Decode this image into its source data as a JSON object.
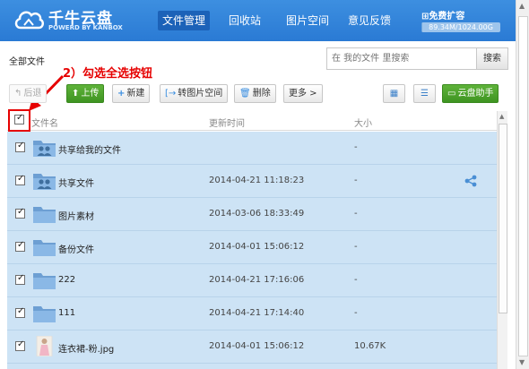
{
  "app": {
    "title": "千牛云盘",
    "subtitle": "POWERD BY KANBOX",
    "logo_icon": "cloud-icon",
    "brand_color": "#2a7ad4"
  },
  "nav": [
    {
      "label": "文件管理",
      "active": true
    },
    {
      "label": "回收站",
      "active": false
    },
    {
      "label": "图片空间",
      "active": false
    },
    {
      "label": "意见反馈",
      "active": false
    }
  ],
  "quota": {
    "title": "免费扩容",
    "usage_text": "89.34M/1024.00G",
    "used_fraction": 0.0001
  },
  "breadcrumb": "全部文件",
  "search": {
    "placeholder": "在 我的文件 里搜索",
    "button_label": "搜索"
  },
  "annotation": {
    "label": "2）勾选全选按钮",
    "color": "#e60000"
  },
  "toolbar": {
    "back_label": "后退",
    "upload_label": "上传",
    "new_label": "新建",
    "to_image_label": "转图片空间",
    "delete_label": "删除",
    "more_label": "更多 >",
    "assistant_label": "云盘助手"
  },
  "table": {
    "columns": [
      "文件名",
      "更新时间",
      "大小"
    ],
    "rows": [
      {
        "name": "共享给我的文件",
        "time": "",
        "size": "-",
        "icon": "shared-folder-icon",
        "shared": false
      },
      {
        "name": "共享文件",
        "time": "2014-04-21 11:18:23",
        "size": "-",
        "icon": "shared-folder-icon",
        "shared": true
      },
      {
        "name": "图片素材",
        "time": "2014-03-06 18:33:49",
        "size": "-",
        "icon": "folder-icon",
        "shared": false
      },
      {
        "name": "备份文件",
        "time": "2014-04-01 15:06:12",
        "size": "-",
        "icon": "folder-icon",
        "shared": false
      },
      {
        "name": "222",
        "time": "2014-04-21 17:16:06",
        "size": "-",
        "icon": "folder-icon",
        "shared": false
      },
      {
        "name": "111",
        "time": "2014-04-21 17:14:40",
        "size": "-",
        "icon": "folder-icon",
        "shared": false
      },
      {
        "name": "连衣裙-粉.jpg",
        "time": "2014-04-01 15:06:12",
        "size": "10.67K",
        "icon": "image-thumbnail-icon",
        "shared": false
      }
    ]
  },
  "selection_color": "#cde3f5"
}
